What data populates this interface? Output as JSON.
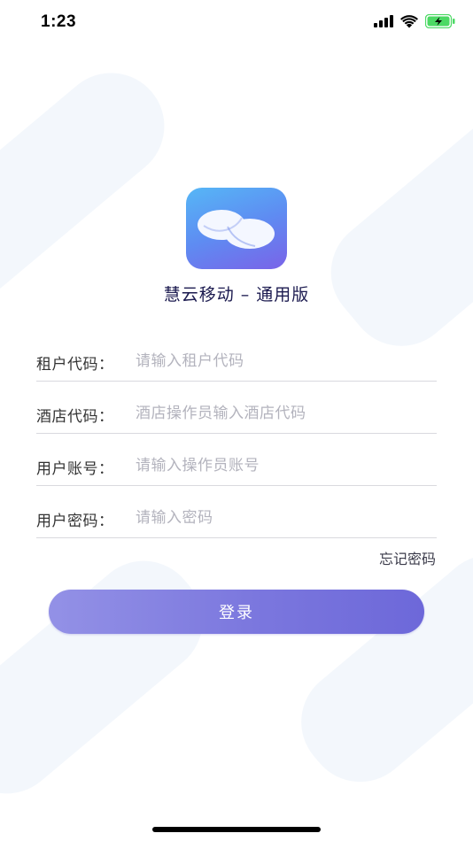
{
  "status_bar": {
    "time": "1:23"
  },
  "app": {
    "title": "慧云移动 – 通用版"
  },
  "form": {
    "fields": [
      {
        "label": "租户代码：",
        "placeholder": "请输入租户代码",
        "value": ""
      },
      {
        "label": "酒店代码：",
        "placeholder": "酒店操作员输入酒店代码",
        "value": ""
      },
      {
        "label": "用户账号：",
        "placeholder": "请输入操作员账号",
        "value": ""
      },
      {
        "label": "用户密码：",
        "placeholder": "请输入密码",
        "value": ""
      }
    ],
    "forgot_password": "忘记密码",
    "login_label": "登录"
  },
  "colors": {
    "accent": "#7b77de",
    "title": "#1b1a4f",
    "placeholder": "#b3b3bd",
    "battery": "#4cd964"
  },
  "icons": {
    "logo": "cloud-icon",
    "signal": "cellular-signal-icon",
    "wifi": "wifi-icon",
    "battery": "battery-charging-icon"
  }
}
